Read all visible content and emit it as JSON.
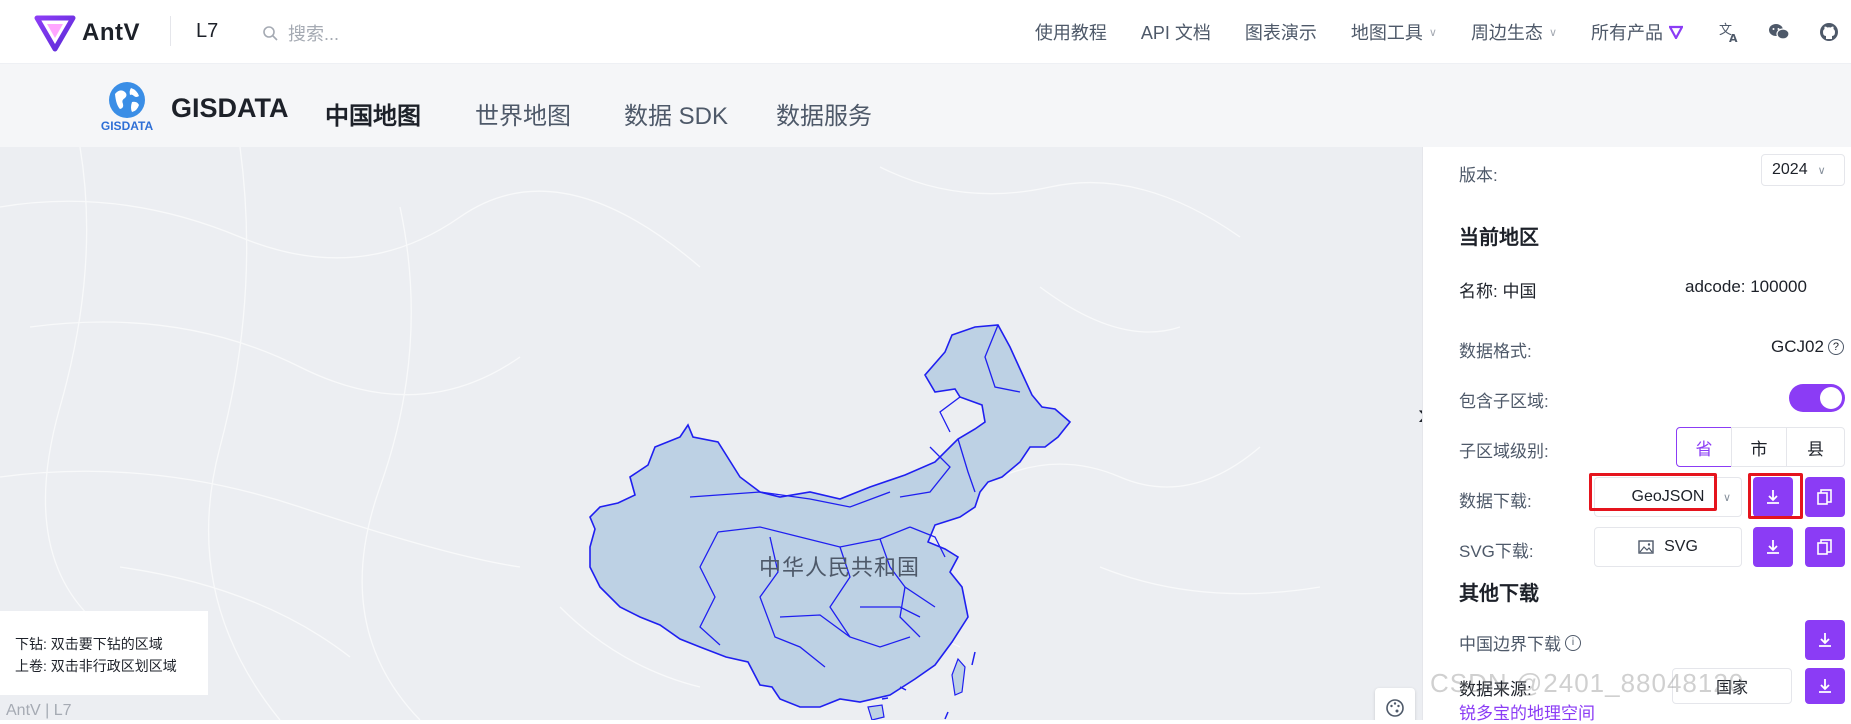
{
  "topnav": {
    "brand": "AntV",
    "product": "L7",
    "search_placeholder": "搜索...",
    "links": [
      {
        "label": "使用教程",
        "dropdown": false
      },
      {
        "label": "API 文档",
        "dropdown": false
      },
      {
        "label": "图表演示",
        "dropdown": false
      },
      {
        "label": "地图工具",
        "dropdown": true
      },
      {
        "label": "周边生态",
        "dropdown": true
      },
      {
        "label": "所有产品",
        "dropdown": false
      }
    ],
    "icons": [
      "translate-icon",
      "wechat-icon",
      "github-icon"
    ]
  },
  "subnav": {
    "logo_label": "GISDATA",
    "title": "GISDATA",
    "tabs": [
      {
        "label": "中国地图",
        "active": true
      },
      {
        "label": "世界地图",
        "active": false
      },
      {
        "label": "数据 SDK",
        "active": false
      },
      {
        "label": "数据服务",
        "active": false
      }
    ]
  },
  "map": {
    "region_label": "中华人民共和国",
    "legend_line1": "下钻: 双击要下钻的区域",
    "legend_line2": "上卷: 双击非行政区划区域",
    "attribution": "AntV | L7",
    "fill_color": "#bdd1e4",
    "stroke_color": "#1f1ff0"
  },
  "panel": {
    "version_label": "版本:",
    "version_value": "2024",
    "current_region_title": "当前地区",
    "name_label": "名称: 中国",
    "adcode_label": "adcode: 100000",
    "format_label": "数据格式:",
    "format_value": "GCJ02",
    "include_children_label": "包含子区域:",
    "include_children_on": true,
    "level_label": "子区域级别:",
    "levels": [
      {
        "label": "省",
        "active": true
      },
      {
        "label": "市",
        "active": false
      },
      {
        "label": "县",
        "active": false
      }
    ],
    "download_label": "数据下载:",
    "download_format": "GeoJSON",
    "svg_label": "SVG下载:",
    "svg_button": "SVG",
    "other_title": "其他下载",
    "border_label": "中国边界下载",
    "source_label": "数据来源:",
    "source_sub": "国家",
    "source_link": "锐多宝的地理空间",
    "accent_color": "#8b3cf5"
  },
  "watermark": "CSDN @2401_88048120"
}
